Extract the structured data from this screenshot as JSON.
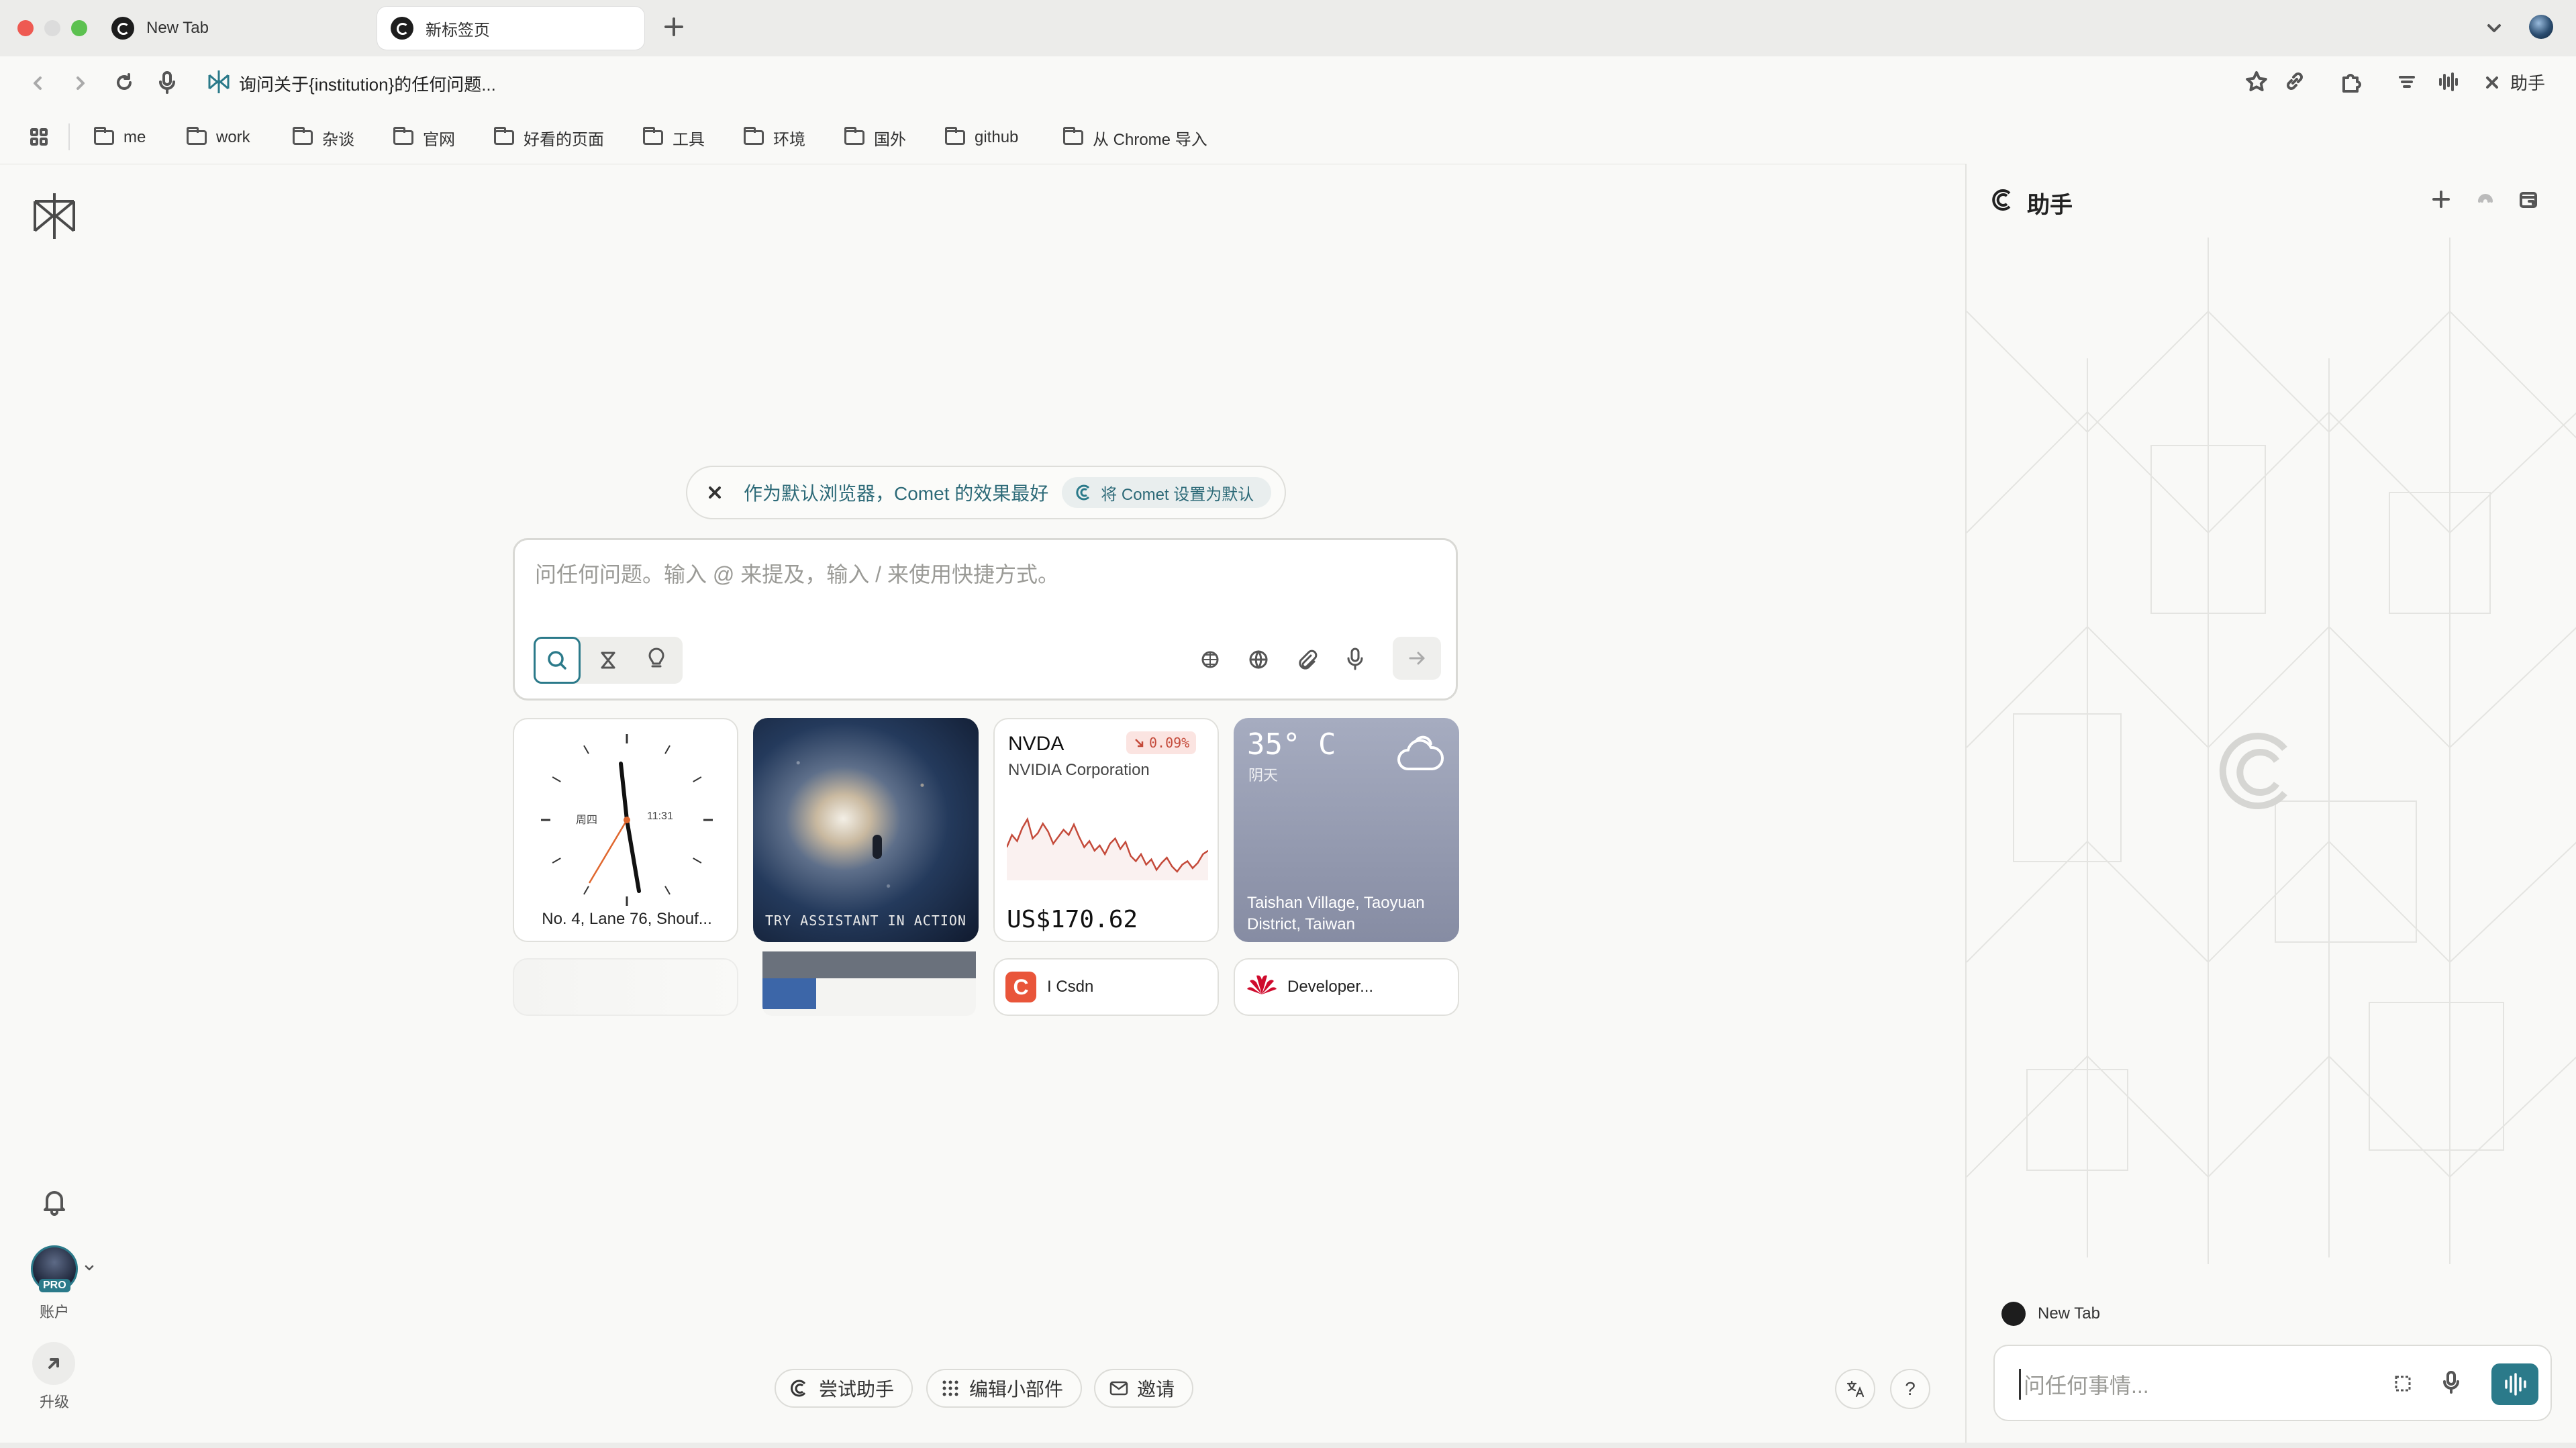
{
  "tabs": [
    {
      "label": "New Tab",
      "active": false
    },
    {
      "label": "新标签页",
      "active": true
    }
  ],
  "omnibox": {
    "text": "询问关于{institution}的任何问题..."
  },
  "toolbar": {
    "assistant_label": "助手"
  },
  "bookmarks": [
    "me",
    "work",
    "杂谈",
    "官网",
    "好看的页面",
    "工具",
    "环境",
    "国外",
    "github",
    "从 Chrome 导入"
  ],
  "rail": {
    "account_label": "账户",
    "upgrade_label": "升级",
    "pro_badge": "PRO"
  },
  "banner": {
    "text": "作为默认浏览器，Comet 的效果最好",
    "button": "将 Comet 设置为默认"
  },
  "search": {
    "placeholder": "问任何问题。输入 @ 来提及，输入 / 来使用快捷方式。"
  },
  "widgets": {
    "clock": {
      "weekday": "周四",
      "time": "11:31",
      "location": "No. 4, Lane 76, Shouf..."
    },
    "promo": {
      "text": "TRY ASSISTANT IN ACTION"
    },
    "stock": {
      "ticker": "NVDA",
      "company": "NVIDIA Corporation",
      "change": "0.09%",
      "price": "US$170.62",
      "sparkline": [
        62,
        48,
        55,
        40,
        30,
        52,
        46,
        35,
        44,
        58,
        50,
        42,
        48,
        36,
        50,
        62,
        55,
        66,
        60,
        70,
        58,
        52,
        64,
        56,
        72,
        78,
        70,
        82,
        76,
        88,
        80,
        74,
        84,
        90,
        82,
        78,
        86,
        80,
        70,
        66
      ]
    },
    "weather": {
      "temp": "35° C",
      "condition": "阴天",
      "location": "Taishan Village, Taoyuan District, Taiwan"
    },
    "shortcuts": [
      {
        "label": "I Csdn"
      },
      {
        "label": "Developer..."
      }
    ]
  },
  "bottom": {
    "try_assistant": "尝试助手",
    "edit_widgets": "编辑小部件",
    "invite": "邀请",
    "help": "?"
  },
  "assistant": {
    "title": "助手",
    "context_tab": "New Tab",
    "placeholder": "问任何事情..."
  },
  "colors": {
    "accent": "#2b7a8a",
    "stock_down": "#c44a3a",
    "csdn": "#e9553a",
    "huawei": "#cf0a2c"
  }
}
